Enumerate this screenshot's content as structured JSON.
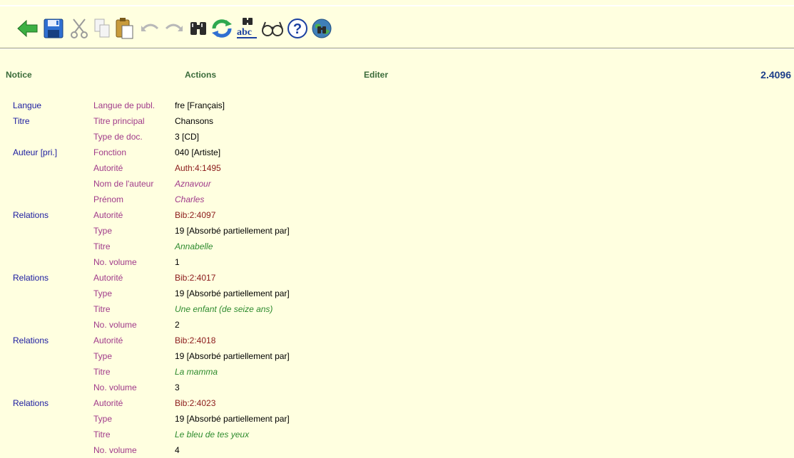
{
  "toolbar": {
    "icons": [
      "back-arrow-icon",
      "save-icon",
      "cut-icon",
      "copy-icon",
      "paste-icon",
      "undo-icon",
      "redo-icon",
      "binoculars-icon",
      "refresh-icon",
      "spellcheck-icon",
      "glasses-icon",
      "help-icon",
      "globe-search-icon"
    ]
  },
  "header": {
    "notice": "Notice",
    "actions": "Actions",
    "editer": "Editer",
    "record_number": "2.4096"
  },
  "rows": [
    {
      "section": "Langue",
      "label": "Langue de publ.",
      "value": "fre [Français]"
    },
    {
      "section": "Titre",
      "label": "Titre principal",
      "value": "Chansons"
    },
    {
      "section": "",
      "label": "Type de doc.",
      "value": "3 [CD]"
    },
    {
      "section": "Auteur [pri.]",
      "label": "Fonction",
      "value": "040 [Artiste]"
    },
    {
      "section": "",
      "label": "Autorité",
      "value": "Auth:4:1495"
    },
    {
      "section": "",
      "label": "Nom de l'auteur",
      "value": "Aznavour"
    },
    {
      "section": "",
      "label": "Prénom",
      "value": "Charles"
    },
    {
      "section": "Relations",
      "label": "Autorité",
      "value": "Bib:2:4097"
    },
    {
      "section": "",
      "label": "Type",
      "value": "19 [Absorbé partiellement par]"
    },
    {
      "section": "",
      "label": "Titre",
      "value": "Annabelle"
    },
    {
      "section": "",
      "label": "No. volume",
      "value": "1"
    },
    {
      "section": "Relations",
      "label": "Autorité",
      "value": "Bib:2:4017"
    },
    {
      "section": "",
      "label": "Type",
      "value": "19 [Absorbé partiellement par]"
    },
    {
      "section": "",
      "label": "Titre",
      "value": "Une enfant (de seize ans)"
    },
    {
      "section": "",
      "label": "No. volume",
      "value": "2"
    },
    {
      "section": "Relations",
      "label": "Autorité",
      "value": "Bib:2:4018"
    },
    {
      "section": "",
      "label": "Type",
      "value": "19 [Absorbé partiellement par]"
    },
    {
      "section": "",
      "label": "Titre",
      "value": "La mamma"
    },
    {
      "section": "",
      "label": "No. volume",
      "value": "3"
    },
    {
      "section": "Relations",
      "label": "Autorité",
      "value": "Bib:2:4023"
    },
    {
      "section": "",
      "label": "Type",
      "value": "19 [Absorbé partiellement par]"
    },
    {
      "section": "",
      "label": "Titre",
      "value": "Le bleu de tes yeux"
    },
    {
      "section": "",
      "label": "No. volume",
      "value": "4"
    }
  ],
  "colors": {
    "background": "#ffffe0",
    "section": "#1a1aa0",
    "label": "#a03a8a",
    "link_value": "#8b1a1a",
    "title_value": "#2e8b2e",
    "header": "#3a6b3a"
  }
}
